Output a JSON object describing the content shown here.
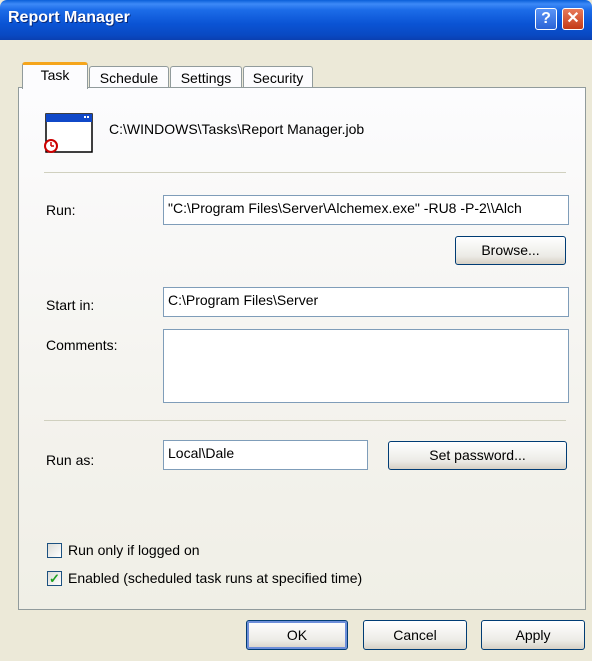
{
  "window": {
    "title": "Report Manager",
    "help_glyph": "?",
    "close_glyph": "✕"
  },
  "tabs": [
    {
      "label": "Task",
      "active": true
    },
    {
      "label": "Schedule",
      "active": false
    },
    {
      "label": "Settings",
      "active": false
    },
    {
      "label": "Security",
      "active": false
    }
  ],
  "task": {
    "job_path": "C:\\WINDOWS\\Tasks\\Report Manager.job",
    "run_label": "Run:",
    "run_value": "\"C:\\Program Files\\Server\\Alchemex.exe\" -RU8 -P-2\\\\Alch",
    "browse_label": "Browse...",
    "start_in_label": "Start in:",
    "start_in_value": "C:\\Program Files\\Server",
    "comments_label": "Comments:",
    "comments_value": "",
    "run_as_label": "Run as:",
    "run_as_value": "Local\\Dale",
    "set_password_label": "Set password...",
    "run_only_logged_on_label": "Run only if logged on",
    "run_only_logged_on_checked": false,
    "enabled_label": "Enabled (scheduled task runs at specified time)",
    "enabled_checked": true,
    "check_glyph": "✓"
  },
  "footer": {
    "ok_label": "OK",
    "cancel_label": "Cancel",
    "apply_label": "Apply"
  },
  "colors": {
    "titlebar": "#0a53d4",
    "tab_highlight": "#f5a51c",
    "dialog_bg": "#ece9d8",
    "checkmark": "#21a121"
  },
  "icons": {
    "job_icon": "scheduled-task-window-icon",
    "help": "help-icon",
    "close": "close-icon"
  }
}
